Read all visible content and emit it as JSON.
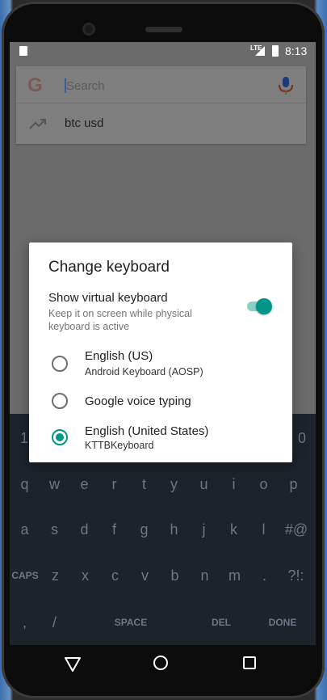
{
  "status_bar": {
    "network": "LTE",
    "time": "8:13"
  },
  "search": {
    "placeholder": "Search",
    "logo": "G",
    "suggestion": "btc usd"
  },
  "dialog": {
    "title": "Change keyboard",
    "virtual_keyboard": {
      "label": "Show virtual keyboard",
      "description": "Keep it on screen while physical keyboard is active",
      "enabled": true
    },
    "options": [
      {
        "title": "English (US)",
        "subtitle": "Android Keyboard (AOSP)",
        "selected": false
      },
      {
        "title": "Google voice typing",
        "subtitle": "",
        "selected": false
      },
      {
        "title": "English (United States)",
        "subtitle": "KTTBKeyboard",
        "selected": true
      }
    ]
  },
  "keyboard": {
    "row0": [
      "1",
      "0"
    ],
    "row1": [
      "q",
      "w",
      "e",
      "r",
      "t",
      "y",
      "u",
      "i",
      "o",
      "p"
    ],
    "row2": [
      "a",
      "s",
      "d",
      "f",
      "g",
      "h",
      "j",
      "k",
      "l",
      "#@"
    ],
    "row3": [
      "CAPS",
      "z",
      "x",
      "c",
      "v",
      "b",
      "n",
      "m",
      ".",
      "?!:"
    ],
    "row4": [
      ",",
      "/",
      "SPACE",
      "DEL",
      "DONE"
    ]
  },
  "colors": {
    "accent": "#009688",
    "keyboard_bg": "#1d232b"
  },
  "icons": {
    "mic": "mic-icon",
    "trend": "trending-icon",
    "back": "back-icon",
    "home": "home-icon",
    "recents": "recents-icon"
  }
}
